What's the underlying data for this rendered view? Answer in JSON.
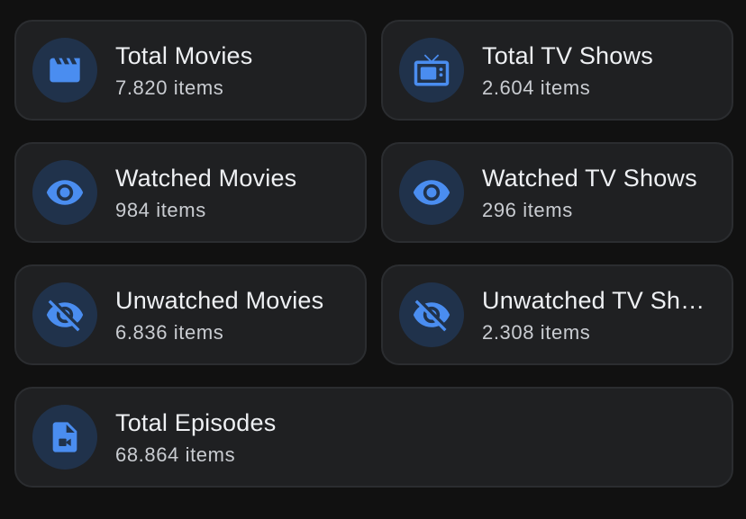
{
  "accent_color": "#4a8df0",
  "cards": [
    {
      "title": "Total Movies",
      "count": "7.820",
      "unit": "items",
      "icon": "movie-clapperboard-icon"
    },
    {
      "title": "Total TV Shows",
      "count": "2.604",
      "unit": "items",
      "icon": "tv-icon"
    },
    {
      "title": "Watched Movies",
      "count": "984",
      "unit": "items",
      "icon": "eye-icon"
    },
    {
      "title": "Watched TV Shows",
      "count": "296",
      "unit": "items",
      "icon": "eye-icon"
    },
    {
      "title": "Unwatched Movies",
      "count": "6.836",
      "unit": "items",
      "icon": "eye-off-icon"
    },
    {
      "title": "Unwatched TV Shows",
      "count": "2.308",
      "unit": "items",
      "icon": "eye-off-icon"
    },
    {
      "title": "Total Episodes",
      "count": "68.864",
      "unit": "items",
      "icon": "video-file-icon"
    }
  ]
}
